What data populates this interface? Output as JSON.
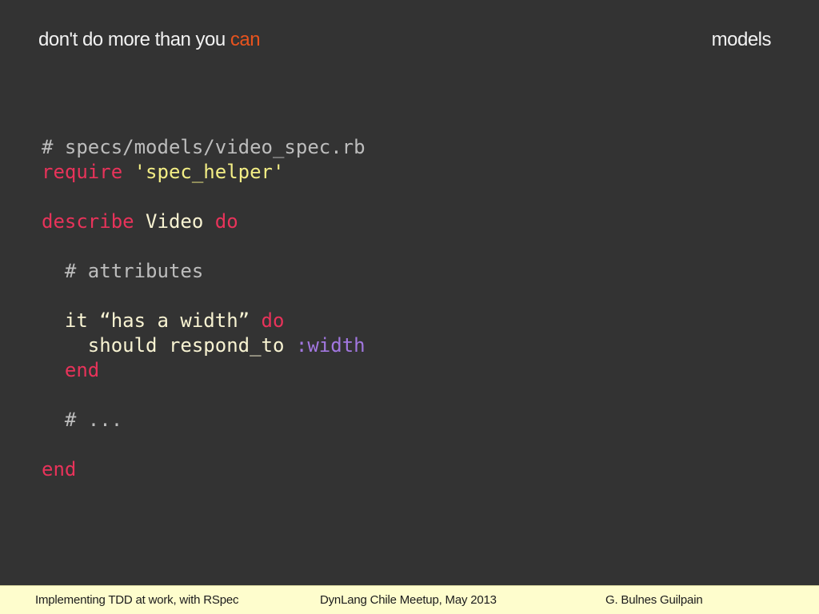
{
  "header": {
    "title_main": "don't do more than you ",
    "title_accent": "can",
    "section": "models"
  },
  "colors": {
    "background": "#333333",
    "title_accent": "#e8531e",
    "comment": "#bdbdbd",
    "keyword": "#e8335a",
    "string": "#f3ee85",
    "symbol": "#a277e0",
    "footer_background": "#fefdcd"
  },
  "code": {
    "line1": {
      "comment": "# specs/models/video_spec.rb"
    },
    "line2": {
      "keyword": "require",
      "sp": " ",
      "string": "'spec_helper'"
    },
    "line3": {
      "blank": ""
    },
    "line4": {
      "keyword": "describe",
      "sp1": " ",
      "plain": "Video",
      "sp2": " ",
      "keyword2": "do"
    },
    "line5": {
      "blank": ""
    },
    "line6": {
      "indent": "  ",
      "comment": "# attributes"
    },
    "line7": {
      "blank": ""
    },
    "line8": {
      "indent": "  ",
      "plain": "it “has a width”",
      "sp": " ",
      "keyword": "do"
    },
    "line9": {
      "indent": "    ",
      "plain": "should respond_to",
      "sp": " ",
      "symbol": ":width"
    },
    "line10": {
      "indent": "  ",
      "keyword": "end"
    },
    "line11": {
      "blank": ""
    },
    "line12": {
      "indent": "  ",
      "comment": "# ..."
    },
    "line13": {
      "blank": ""
    },
    "line14": {
      "keyword": "end"
    }
  },
  "footer": {
    "left": "Implementing TDD at work, with RSpec",
    "middle": "DynLang Chile Meetup, May 2013",
    "right": "G. Bulnes Guilpain"
  }
}
